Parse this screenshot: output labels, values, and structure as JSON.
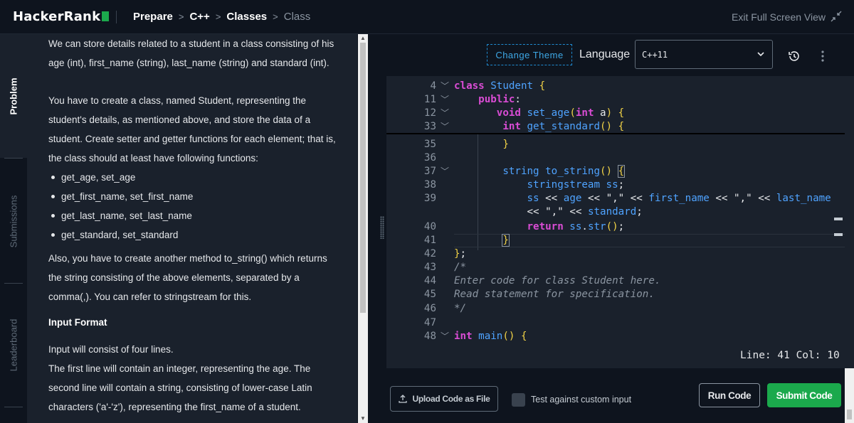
{
  "header": {
    "logo": "HackerRank",
    "breadcrumbs": [
      "Prepare",
      "C++",
      "Classes",
      "Class"
    ],
    "exit_full_screen": "Exit Full Screen View"
  },
  "sidebar_tabs": [
    "Problem",
    "Submissions",
    "Leaderboard"
  ],
  "problem": {
    "p1": "We can store details related to a student in a class consisting of his age (int), first_name (string), last_name (string) and standard (int).",
    "p2": "You have to create a class, named Student, representing the student's details, as mentioned above, and store the data of a student. Create setter and getter functions for each element; that is, the class should at least have following functions:",
    "functions": [
      "get_age, set_age",
      "get_first_name, set_first_name",
      "get_last_name, set_last_name",
      "get_standard, set_standard"
    ],
    "p3": "Also, you have to create another method to_string() which returns the string consisting of the above elements, separated by a comma(,). You can refer to stringstream for this.",
    "input_format_heading": "Input Format",
    "p4": "Input will consist of four lines.",
    "p5": "The first line will contain an integer, representing the age. The second line will contain a string, consisting of lower-case Latin characters ('a'-'z'), representing the first_name of a student."
  },
  "toolbar": {
    "change_theme": "Change Theme",
    "language_label": "Language",
    "language_value": "C++11"
  },
  "code": {
    "sticky_lines": [
      "4",
      "11",
      "12",
      "33"
    ],
    "line_numbers": [
      "35",
      "36",
      "37",
      "38",
      "39",
      "",
      "40",
      "41",
      "42",
      "43",
      "44",
      "45",
      "46",
      "47",
      "48"
    ]
  },
  "status": "Line: 41 Col: 10",
  "bottom": {
    "upload": "Upload Code as File",
    "custom_input": "Test against custom input",
    "run": "Run Code",
    "submit": "Submit Code"
  },
  "colors": {
    "accent_green": "#1ba94c",
    "keyword": "#d94cd4",
    "type": "#4fa3ff",
    "bracket": "#f1d246",
    "comment": "#8b95a1"
  }
}
